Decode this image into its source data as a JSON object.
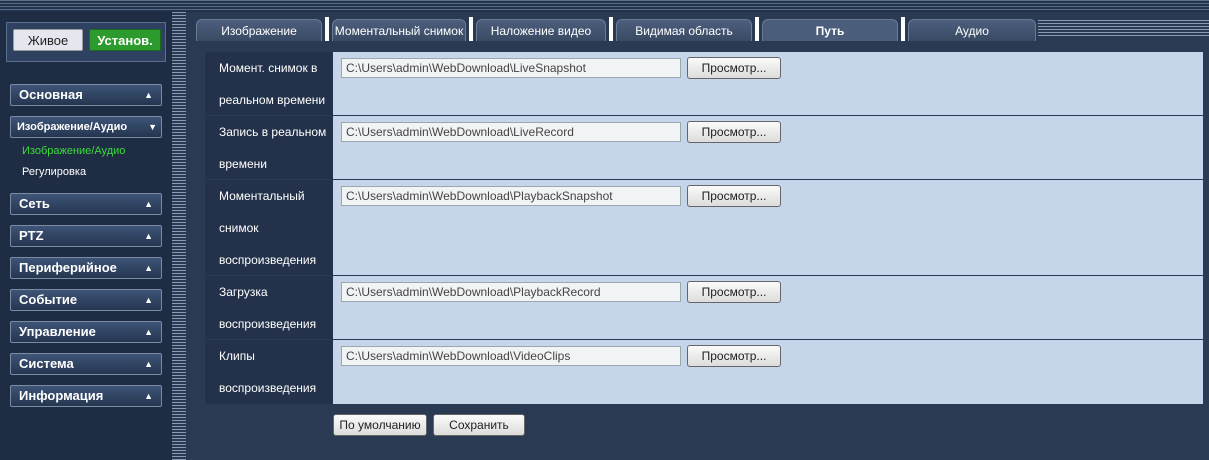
{
  "mode": {
    "live_label": "Живое",
    "setup_label": "Установ."
  },
  "nav": {
    "items": [
      {
        "label": "Основная",
        "arrow": "▲"
      },
      {
        "label": "Изображение/Аудио",
        "arrow": "▼"
      },
      {
        "label": "Сеть",
        "arrow": "▲"
      },
      {
        "label": "PTZ",
        "arrow": "▲"
      },
      {
        "label": "Периферийное",
        "arrow": "▲"
      },
      {
        "label": "Событие",
        "arrow": "▲"
      },
      {
        "label": "Управление",
        "arrow": "▲"
      },
      {
        "label": "Система",
        "arrow": "▲"
      },
      {
        "label": "Информация",
        "arrow": "▲"
      }
    ],
    "subitems": [
      {
        "label": "Изображение/Аудио"
      },
      {
        "label": "Регулировка"
      }
    ]
  },
  "tabs": [
    {
      "label": "Изображение"
    },
    {
      "label": "Моментальный снимок"
    },
    {
      "label": "Наложение видео"
    },
    {
      "label": "Видимая область"
    },
    {
      "label": "Путь"
    },
    {
      "label": "Аудио"
    }
  ],
  "rows": [
    {
      "label_lines": [
        "Момент. снимок в",
        "реальном времени"
      ],
      "path": "C:\\Users\\admin\\WebDownload\\LiveSnapshot",
      "browse": "Просмотр..."
    },
    {
      "label_lines": [
        "Запись в реальном",
        "времени"
      ],
      "path": "C:\\Users\\admin\\WebDownload\\LiveRecord",
      "browse": "Просмотр..."
    },
    {
      "label_lines": [
        "Моментальный",
        "снимок",
        "воспроизведения"
      ],
      "path": "C:\\Users\\admin\\WebDownload\\PlaybackSnapshot",
      "browse": "Просмотр..."
    },
    {
      "label_lines": [
        "Загрузка",
        "воспроизведения"
      ],
      "path": "C:\\Users\\admin\\WebDownload\\PlaybackRecord",
      "browse": "Просмотр..."
    },
    {
      "label_lines": [
        "Клипы",
        "воспроизведения"
      ],
      "path": "C:\\Users\\admin\\WebDownload\\VideoClips",
      "browse": "Просмотр..."
    }
  ],
  "actions": {
    "default_label": "По умолчанию",
    "save_label": "Сохранить"
  },
  "colors": {
    "accent_green": "#2c9a2c",
    "active_sub": "#3cdc3c",
    "panel_bg": "#c6d5ea",
    "label_bg": "#23324a"
  }
}
